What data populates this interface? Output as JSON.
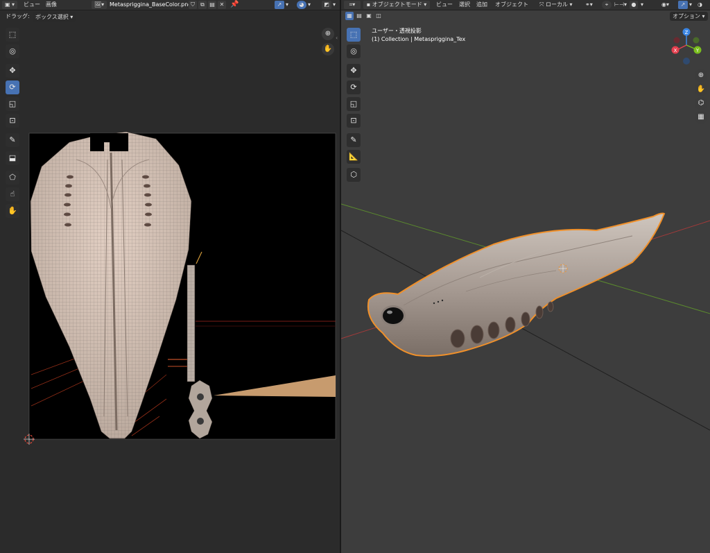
{
  "left_editor": {
    "header": {
      "editor_type_icon": "image-editor-icon",
      "menu_view": "ビュー",
      "menu_image": "画像",
      "image_browse_icon": "image-browse-icon",
      "image_name": "Metaspriggina_BaseColor.png",
      "pin_icon": "pin-icon"
    },
    "subheader": {
      "drag_label": "ドラッグ:",
      "drag_mode": "ボックス選択"
    },
    "tools": [
      "select-box-icon",
      "cursor-icon",
      "move-icon",
      "rotate-icon",
      "scale-icon",
      "transform-icon",
      "annotate-icon",
      "sample-icon",
      "grab-icon",
      "relax-icon",
      "pinch-icon",
      "smooth-icon"
    ],
    "active_tool": "rotate-icon",
    "nav": [
      "zoom-icon",
      "pan-hand-icon"
    ],
    "texture": {
      "background_color": "#000000",
      "skin_color": "#c9b8aa",
      "wire_color": "#4a4a4a"
    }
  },
  "right_editor": {
    "header": {
      "editor_type_icon": "3d-viewport-icon",
      "mode": "オブジェクトモード",
      "menu_view": "ビュー",
      "menu_select": "選択",
      "menu_add": "追加",
      "menu_object": "オブジェクト",
      "transform_orientation": "ローカル",
      "options_label": "オプション"
    },
    "overlay_text": {
      "view_name": "ユーザー・透視投影",
      "collection": "(1) Collection | Metaspriggina_Tex"
    },
    "gizmo": {
      "x": "X",
      "y": "Y",
      "z": "Z",
      "x_color": "#e4404f",
      "y_color": "#7bbf1e",
      "z_color": "#3b86e4"
    },
    "tools": [
      "select-box-icon",
      "cursor-icon",
      "move-icon",
      "rotate-icon",
      "scale-icon",
      "transform-icon",
      "annotate-icon",
      "measure-icon",
      "add-cube-icon"
    ],
    "active_tool": "select-box-icon",
    "nav": [
      "zoom-icon",
      "pan-hand-icon",
      "camera-icon",
      "grid-view-icon"
    ],
    "grid": {
      "x_axis_color": "#a33a3a",
      "y_axis_color": "#5b8a2e",
      "line_color": "#1f1f1f"
    },
    "selection_outline_color": "#f0902a"
  }
}
